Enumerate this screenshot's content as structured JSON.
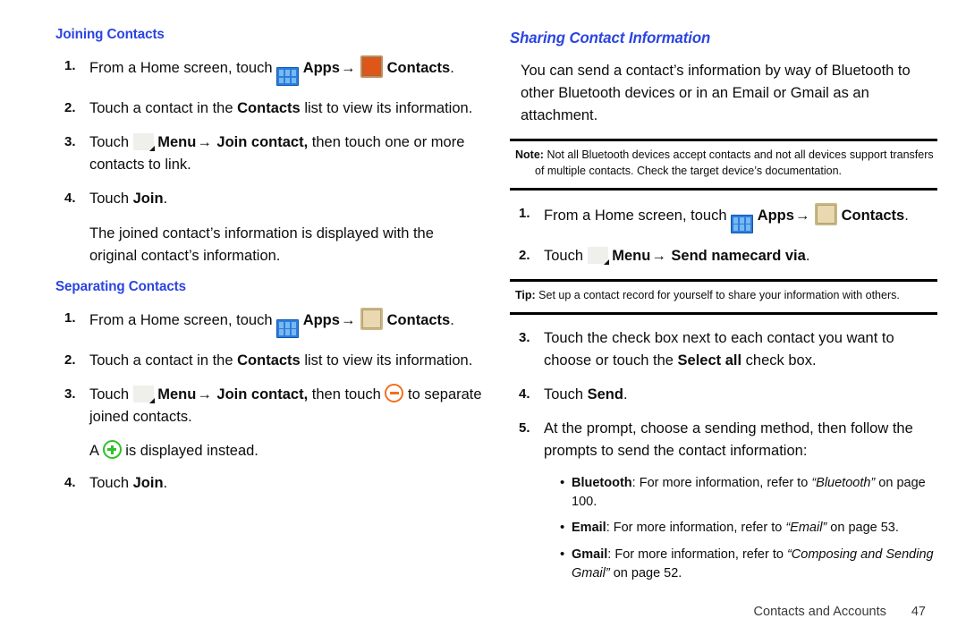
{
  "document": {
    "footer": {
      "chapter": "Contacts and Accounts",
      "page_number": "47"
    }
  },
  "left_column": {
    "joining": {
      "heading": "Joining Contacts",
      "steps": [
        {
          "num": "1.",
          "pre": "From a Home screen, touch",
          "apps_label": "Apps",
          "arrow": "→",
          "contacts_label": "Contacts",
          "post": "."
        },
        {
          "num": "2.",
          "pre": "Touch a contact in the",
          "bold": "Contacts",
          "post": "list to view its information."
        },
        {
          "num": "3.",
          "pre": "Touch",
          "menu_label": "Menu",
          "arrow": "→",
          "action_label": "Join contact,",
          "post": "then touch one or more contacts to link."
        },
        {
          "num": "4.",
          "pre": "Touch",
          "bold": "Join",
          "post": "."
        }
      ],
      "result_paragraph": "The joined contact’s information is displayed with the original contact’s information."
    },
    "separating": {
      "heading": "Separating Contacts",
      "steps": [
        {
          "num": "1.",
          "pre": "From a Home screen, touch",
          "apps_label": "Apps",
          "arrow": "→",
          "contacts_label": "Contacts",
          "post": "."
        },
        {
          "num": "2.",
          "pre": "Touch a contact in the",
          "bold": "Contacts",
          "post": "list to view its information."
        },
        {
          "num": "3.",
          "pre": "Touch",
          "menu_label": "Menu",
          "arrow": "→",
          "action_label": "Join contact,",
          "mid": "then touch",
          "post": "to separate joined contacts."
        }
      ],
      "plus_note_pre": "A",
      "plus_note_post": "is displayed instead.",
      "final_step": {
        "num": "4.",
        "pre": "Touch",
        "bold": "Join",
        "post": "."
      }
    }
  },
  "right_column": {
    "heading": "Sharing Contact Information",
    "intro": "You can send a contact’s information by way of Bluetooth to other Bluetooth devices or in an Email or Gmail as an attachment.",
    "note": {
      "label": "Note:",
      "text": "Not all Bluetooth devices accept contacts and not all devices support transfers of multiple contacts. Check the target device’s documentation."
    },
    "steps_top": [
      {
        "num": "1.",
        "pre": "From a Home screen, touch",
        "apps_label": "Apps",
        "arrow": "→",
        "contacts_label": "Contacts",
        "post": "."
      },
      {
        "num": "2.",
        "pre": "Touch",
        "menu_label": "Menu",
        "arrow": "→",
        "action_label": "Send namecard via",
        "post": "."
      }
    ],
    "tip": {
      "label": "Tip:",
      "text": "Set up a contact record for yourself to share your information with others."
    },
    "steps_bottom": [
      {
        "num": "3.",
        "pre": "Touch the check box next to each contact you want to choose or touch the",
        "bold": "Select all",
        "post": "check box."
      },
      {
        "num": "4.",
        "pre": "Touch",
        "bold": "Send",
        "post": "."
      },
      {
        "num": "5.",
        "text": "At the prompt, choose a sending method, then follow the prompts to send the contact information:"
      }
    ],
    "bullets": [
      {
        "label": "Bluetooth",
        "pre": ": For more information, refer to",
        "ref": "“Bluetooth”",
        "post": "on page 100."
      },
      {
        "label": "Email",
        "pre": ": For more information, refer to",
        "ref": "“Email”",
        "post": "on page 53."
      },
      {
        "label": "Gmail",
        "pre": ": For more information, refer to",
        "ref": "“Composing and Sending Gmail”",
        "post": "on page 52."
      }
    ]
  },
  "icons": {
    "apps": "apps-grid-icon",
    "contacts": "contacts-person-icon",
    "menu": "menu-bars-icon",
    "minus": "minus-circle-icon",
    "plus": "plus-circle-icon"
  },
  "colors": {
    "heading": "#2b45e0",
    "apps_icon": "#2a7ee0",
    "contacts_icon_orange": "#e0551a",
    "contacts_icon_tan": "#ead9b0",
    "minus_icon": "#f2701d",
    "plus_icon": "#2fc128"
  }
}
